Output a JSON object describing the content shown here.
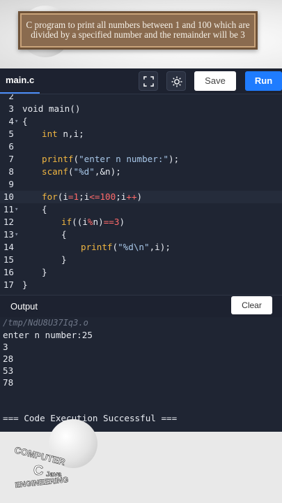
{
  "banner": {
    "line1": "C program to print all numbers between 1 and 100 which are",
    "line2": "divided by a specified number and the remainder will be 3"
  },
  "toolbar": {
    "file_tab": "main.c",
    "fullscreen_icon": "fullscreen-icon",
    "theme_icon": "brightness-icon",
    "save_label": "Save",
    "run_label": "Run",
    "colors": {
      "run": "#1f7cff",
      "save": "#ffffff"
    }
  },
  "editor": {
    "line_numbers": [
      "2",
      "3",
      "4",
      "5",
      "6",
      "7",
      "8",
      "9",
      "10",
      "11",
      "12",
      "13",
      "14",
      "15",
      "16",
      "17"
    ],
    "lines": {
      "l3": "void main()",
      "l4": "{",
      "l5_kw": "int",
      "l5_rest": " n,i;",
      "l7_fn": "printf",
      "l7_open": "(",
      "l7_str": "\"enter n number:\"",
      "l7_close": ");",
      "l8_fn": "scanf",
      "l8_open": "(",
      "l8_str": "\"%d\"",
      "l8_rest": ",&n);",
      "l10_kw": "for",
      "l10_a": "(i",
      "l10_op1": "=",
      "l10_n1": "1",
      "l10_b": ";i",
      "l10_op2": "<=",
      "l10_n2": "100",
      "l10_c": ";i",
      "l10_op3": "++",
      "l10_d": ")",
      "l11": "{",
      "l12_kw": "if",
      "l12_a": "((i",
      "l12_op1": "%",
      "l12_b": "n)",
      "l12_op2": "==",
      "l12_n": "3",
      "l12_c": ")",
      "l13": "{",
      "l14_fn": "printf",
      "l14_open": "(",
      "l14_str": "\"%d\\n\"",
      "l14_rest": ",i);",
      "l15": "}",
      "l16": "}",
      "l17": "}"
    }
  },
  "output": {
    "label": "Output",
    "clear_label": "Clear",
    "lines": [
      "/tmp/NdU8U37Iq3.o",
      "enter n number:25",
      "3",
      "28",
      "53",
      "78",
      "=== Code Execution Successful ==="
    ]
  },
  "logo": {
    "word1": "COMPUTER",
    "word2": "ENGINEERING",
    "letter_c": "C",
    "java": "Java"
  }
}
